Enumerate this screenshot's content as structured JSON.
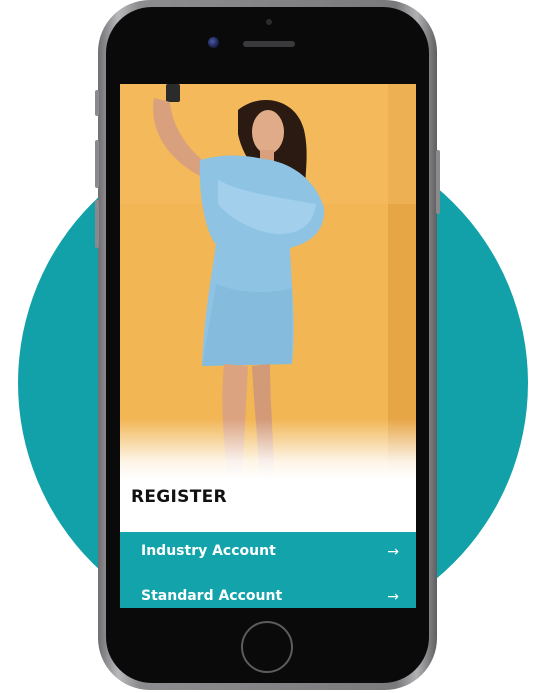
{
  "register": {
    "title": "REGISTER"
  },
  "accounts": [
    {
      "label": "Industry Account",
      "icon": "arrow-right-icon",
      "glyph": "→"
    },
    {
      "label": "Standard Account",
      "icon": "arrow-right-icon",
      "glyph": "→"
    }
  ],
  "colors": {
    "accent": "#13a3ab",
    "photo_background": "#f1b44f"
  },
  "hero_image": {
    "subject": "woman in light blue dress taking a selfie"
  }
}
